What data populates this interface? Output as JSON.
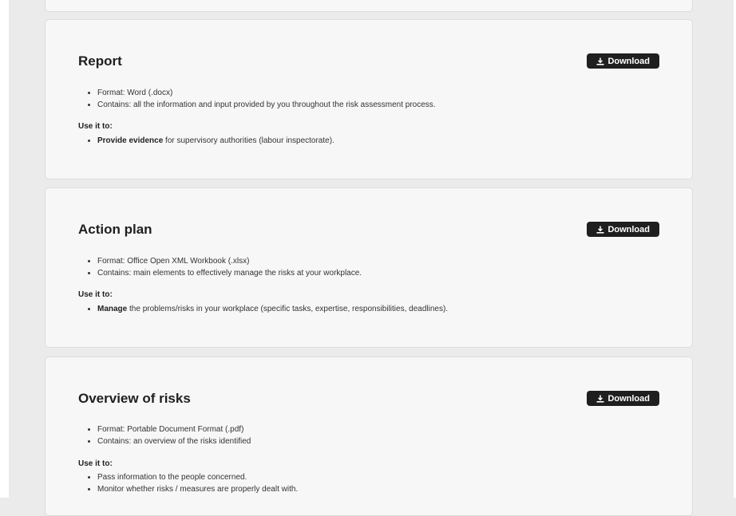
{
  "download_label": "Download",
  "cards": {
    "report": {
      "title": "Report",
      "format": "Format: Word (.docx)",
      "contains": "Contains: all the information and input provided by you throughout the risk assessment process.",
      "use_label": "Use it to:",
      "use_items": [
        {
          "bold": "Provide evidence",
          "rest": " for supervisory authorities (labour inspectorate)."
        }
      ]
    },
    "action_plan": {
      "title": "Action plan",
      "format": "Format: Office Open XML Workbook (.xlsx)",
      "contains": "Contains: main elements to effectively manage the risks at your workplace.",
      "use_label": "Use it to:",
      "use_items": [
        {
          "bold": "Manage",
          "rest": " the problems/risks in your workplace (specific tasks, expertise, responsibilities, deadlines)."
        }
      ]
    },
    "overview": {
      "title": "Overview of risks",
      "format": "Format: Portable Document Format (.pdf)",
      "contains": "Contains: an overview of the risks identified",
      "use_label": "Use it to:",
      "use_items": [
        {
          "text": "Pass information to the people concerned."
        },
        {
          "text": "Monitor whether risks / measures are properly dealt with."
        }
      ]
    }
  }
}
